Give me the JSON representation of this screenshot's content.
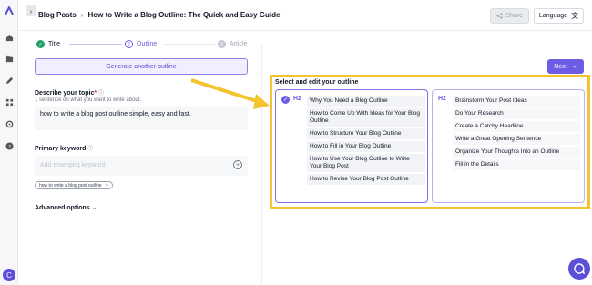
{
  "header": {
    "breadcrumb_root": "Blog Posts",
    "breadcrumb_sep": "›",
    "title": "How to Write a Blog Outline: The Quick and Easy Guide",
    "share_label": "Share",
    "language_label": "Language"
  },
  "steps": [
    {
      "label": "Title",
      "number": "",
      "state": "done"
    },
    {
      "label": "Outline",
      "number": "2",
      "state": "active"
    },
    {
      "label": "Article",
      "number": "3",
      "state": "pending"
    }
  ],
  "generate_button": "Generate another outline",
  "topic": {
    "label": "Describe your topic",
    "required_mark": "*",
    "hint": "1 sentence on what you want to write about.",
    "value": "how to write a blog post outline simple, easy and fast."
  },
  "keyword": {
    "label": "Primary keyword",
    "placeholder": "Add emerging keyword",
    "chip": "how to write a blog post outline",
    "chip_remove": "×"
  },
  "advanced_options": "Advanced options",
  "next_button": "Next",
  "outline": {
    "heading": "Select and edit your outline",
    "left": {
      "tag": "H2",
      "items": [
        "Why You Need a Blog Outline",
        "How to Come Up With Ideas for Your Blog Outline",
        "How to Structure Your Blog Outline",
        "How to Fill in Your Blog Outline",
        "How to Use Your Blog Outline to Write Your Blog Post",
        "How to Revise Your Blog Post Outline"
      ]
    },
    "right": {
      "tag": "H2",
      "items": [
        "Brainstorm Your Post Ideas",
        "Do Your Research",
        "Create a Catchy Headline",
        "Write a Great Opening Sentence",
        "Organize Your Thoughts Into an Outline",
        "Fill in the Details"
      ]
    }
  },
  "user_avatar": "C",
  "colors": {
    "accent": "#6d5ce6",
    "highlight": "#f4c330",
    "done": "#22a06b"
  }
}
